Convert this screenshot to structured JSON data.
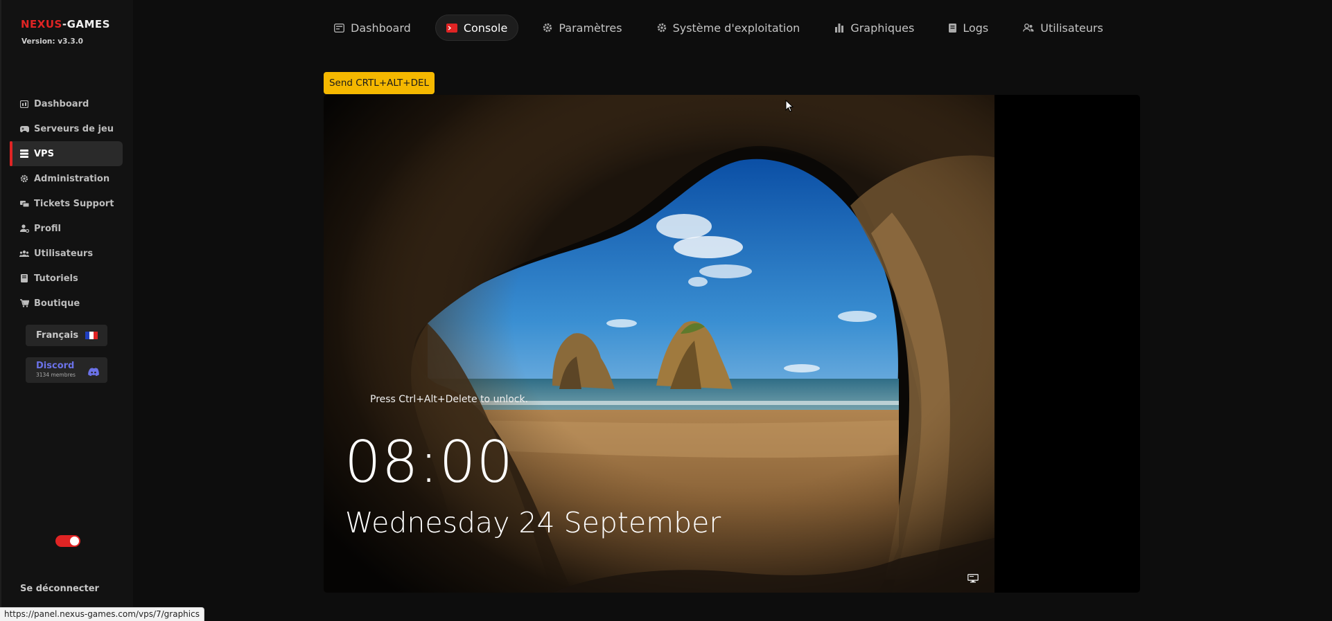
{
  "sidebar": {
    "brand_prefix": "NEXUS",
    "brand_suffix": "-GAMES",
    "version": "Version: v3.3.0",
    "items": [
      {
        "label": "Dashboard",
        "icon": "dashboard-icon"
      },
      {
        "label": "Serveurs de jeu",
        "icon": "gamepad-icon"
      },
      {
        "label": "VPS",
        "icon": "server-icon",
        "active": true
      },
      {
        "label": "Administration",
        "icon": "gear-icon"
      },
      {
        "label": "Tickets Support",
        "icon": "ticket-icon"
      },
      {
        "label": "Profil",
        "icon": "user-gear-icon"
      },
      {
        "label": "Utilisateurs",
        "icon": "users-icon"
      },
      {
        "label": "Tutoriels",
        "icon": "book-icon"
      },
      {
        "label": "Boutique",
        "icon": "cart-icon"
      }
    ],
    "language": "Français",
    "discord_label": "Discord",
    "discord_members": "3134 membres",
    "logout": "Se déconnecter"
  },
  "topnav": {
    "tabs": [
      {
        "label": "Dashboard",
        "icon": "dashboard-icon"
      },
      {
        "label": "Console",
        "icon": "terminal-icon",
        "active": true
      },
      {
        "label": "Paramètres",
        "icon": "gear-icon"
      },
      {
        "label": "Système d'exploitation",
        "icon": "gear-icon"
      },
      {
        "label": "Graphiques",
        "icon": "bar-chart-icon"
      },
      {
        "label": "Logs",
        "icon": "log-icon"
      },
      {
        "label": "Utilisateurs",
        "icon": "users-icon"
      }
    ]
  },
  "console": {
    "send_cad_label": "Send CRTL+ALT+DEL",
    "unlock_text": "Press Ctrl+Alt+Delete to unlock.",
    "time": "08:00",
    "date": "Wednesday 24 September"
  },
  "status_url": "https://panel.nexus-games.com/vps/7/graphics",
  "colors": {
    "accent": "#e02424",
    "button_yellow": "#f5b800",
    "background": "#0d0d0d",
    "sidebar": "#121212",
    "discord": "#6b72e8"
  }
}
